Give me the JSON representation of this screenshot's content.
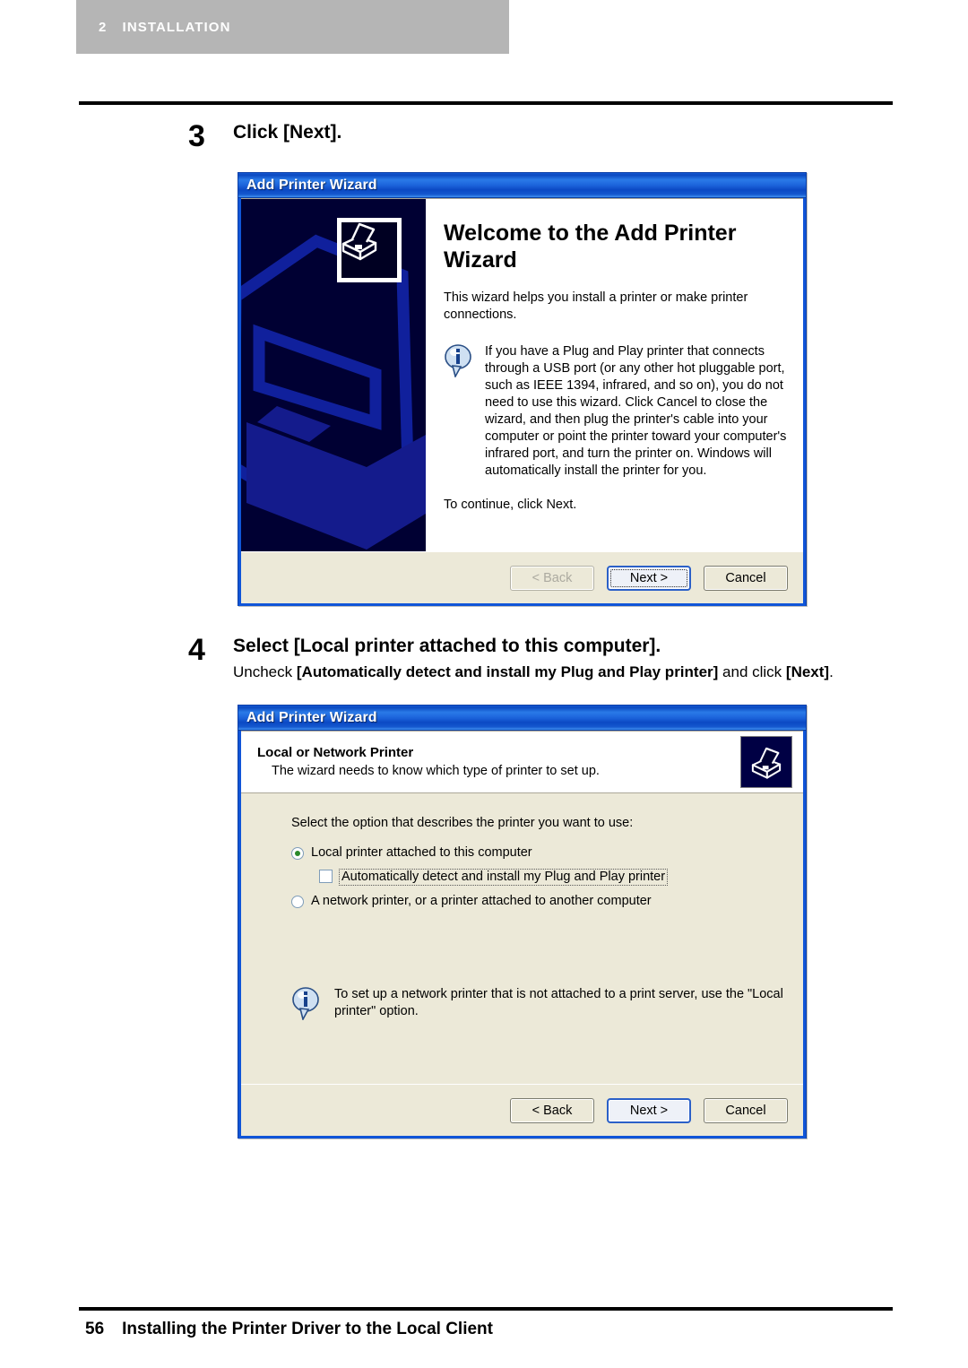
{
  "page": {
    "chapter_number": "2",
    "chapter_title": "INSTALLATION",
    "footer_page_number": "56",
    "footer_title": "Installing the Printer Driver to the Local Client"
  },
  "colors": {
    "banner_gray": "#b5b5b5",
    "titlebar_blue": "#1055d8",
    "dialog_face": "#ece9d8",
    "wizard_banner_navy": "#000033",
    "radio_green": "#2a8a2a"
  },
  "steps": [
    {
      "number": "3",
      "title": "Click [Next].",
      "subtitle": ""
    },
    {
      "number": "4",
      "title": "Select [Local printer attached to this computer].",
      "sub_prefix": "Uncheck ",
      "sub_bold1": "[Automatically detect and install my Plug and Play printer]",
      "sub_mid": " and click ",
      "sub_bold2": "[Next]",
      "sub_suffix": "."
    }
  ],
  "dialog_welcome": {
    "title": "Add Printer Wizard",
    "icon_name": "printer-icon",
    "heading": "Welcome to the Add Printer Wizard",
    "paragraph": "This wizard helps you install a printer or make printer connections.",
    "note_icon": "info-icon",
    "note": "If you have a Plug and Play printer that connects through a USB port (or any other hot pluggable port, such as IEEE 1394, infrared, and so on), you do not need to use this wizard. Click Cancel to close the wizard, and then plug the printer's cable into your computer or point the printer toward your computer's infrared port, and turn the printer on. Windows will automatically install the printer for you.",
    "continue": "To continue, click Next.",
    "buttons": {
      "back": "< Back",
      "back_enabled": false,
      "next": "Next >",
      "next_default": true,
      "next_focused": true,
      "cancel": "Cancel"
    }
  },
  "dialog_local": {
    "title": "Add Printer Wizard",
    "header_title": "Local or Network Printer",
    "header_sub": "The wizard needs to know which type of printer to set up.",
    "header_icon": "printer-icon",
    "prompt": "Select the option that describes the printer you want to use:",
    "option_local": {
      "label": "Local printer attached to this computer",
      "selected": true
    },
    "checkbox_autodetect": {
      "label": "Automatically detect and install my Plug and Play printer",
      "checked": false,
      "focused": true
    },
    "option_network": {
      "label": "A network printer, or a printer attached to another computer",
      "selected": false
    },
    "note_icon": "info-icon",
    "note": "To set up a network printer that is not attached to a print server, use the \"Local printer\" option.",
    "buttons": {
      "back": "< Back",
      "back_enabled": true,
      "next": "Next >",
      "next_default": true,
      "cancel": "Cancel"
    }
  }
}
